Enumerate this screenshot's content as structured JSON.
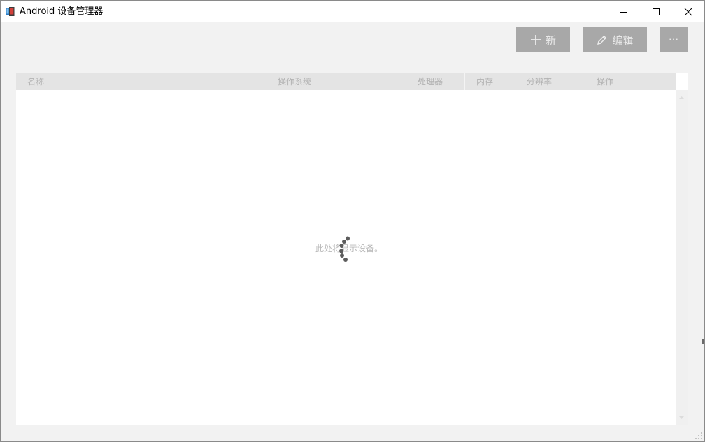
{
  "window": {
    "title": "Android 设备管理器",
    "colors": {
      "titlebar": "#ffffff",
      "background": "#f2f2f2"
    }
  },
  "toolbar": {
    "new_label": "新",
    "edit_label": "编辑",
    "more_label": "···",
    "button_color": "#a8a8a8"
  },
  "table": {
    "columns": [
      "名称",
      "操作系统",
      "处理器",
      "内存",
      "分辨率",
      "操作"
    ],
    "rows": [],
    "empty_message": "此处将显示设备。"
  },
  "icons": {
    "app": "android-device-manager-icon",
    "minimize": "minimize-icon",
    "maximize": "maximize-icon",
    "close": "close-icon",
    "new": "plus-icon",
    "edit": "pencil-icon",
    "spinner": "loading-spinner-icon"
  }
}
